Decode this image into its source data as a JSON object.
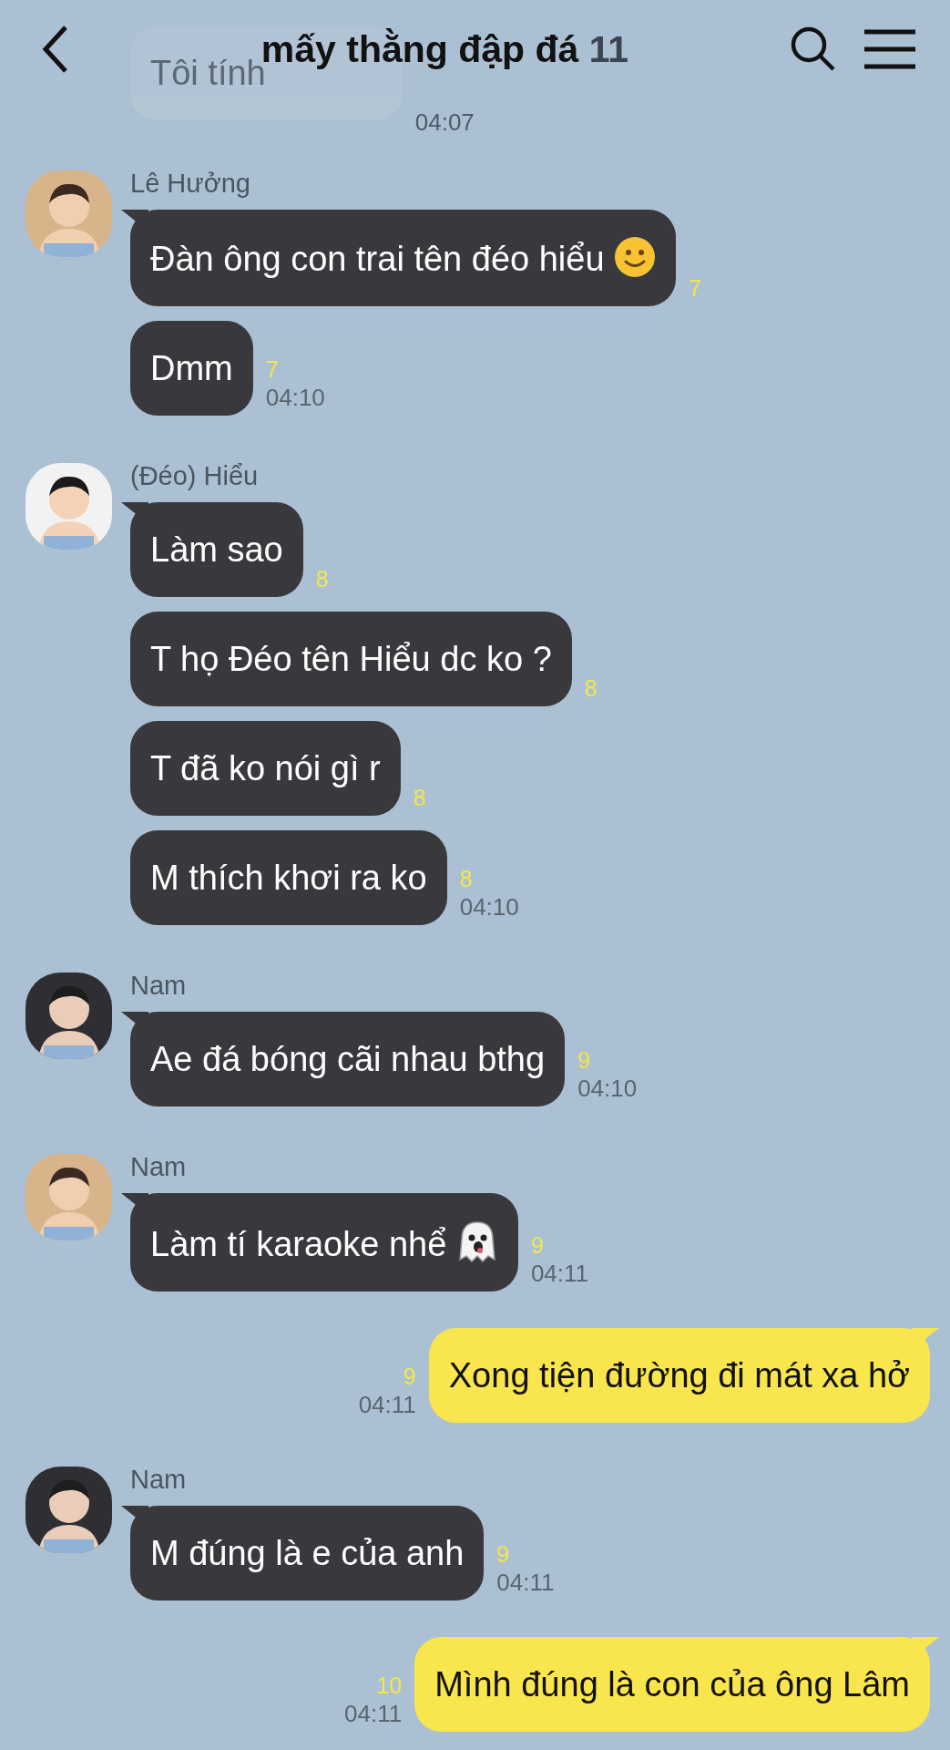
{
  "header": {
    "title": "mấy thằng đập đá",
    "member_count": "11"
  },
  "groups": [
    {
      "kind": "partial",
      "messages": [
        {
          "text": "Tôi tính",
          "time": "04:07"
        }
      ]
    },
    {
      "kind": "incoming",
      "sender": "Lê Hưởng",
      "avatar": {
        "kind": "picture"
      },
      "messages": [
        {
          "kind": "text_smiley",
          "text": "Đàn ông con trai tên đéo hiểu",
          "unread": "7"
        },
        {
          "text": "Dmm",
          "unread": "7",
          "time": "04:10"
        }
      ]
    },
    {
      "kind": "incoming",
      "sender": "(Đéo) Hiểu",
      "avatar": {
        "kind": "picture"
      },
      "messages": [
        {
          "text": "Làm sao",
          "unread": "8"
        },
        {
          "text": "T họ Đéo tên Hiểu dc ko ?",
          "unread": "8"
        },
        {
          "text": "T đã ko nói gì r",
          "unread": "8"
        },
        {
          "text": "M thích khơi ra ko",
          "unread": "8",
          "time": "04:10"
        }
      ]
    },
    {
      "kind": "incoming",
      "sender": "Nam",
      "avatar": {
        "kind": "picture"
      },
      "messages": [
        {
          "text": "Ae đá bóng cãi nhau bthg",
          "unread": "9",
          "time": "04:10"
        }
      ]
    },
    {
      "kind": "incoming",
      "sender": "Nam",
      "avatar": {
        "kind": "picture"
      },
      "messages": [
        {
          "kind": "text_ghost",
          "text": "Làm tí karaoke nhể",
          "unread": "9",
          "time": "04:11"
        }
      ]
    },
    {
      "kind": "outgoing",
      "messages": [
        {
          "text": "Xong tiện đường đi mát xa hở",
          "unread": "9",
          "time": "04:11"
        }
      ]
    },
    {
      "kind": "incoming",
      "sender": "Nam",
      "avatar": {
        "kind": "picture"
      },
      "messages": [
        {
          "text": "M đúng là e của anh",
          "unread": "9",
          "time": "04:11"
        }
      ]
    },
    {
      "kind": "outgoing",
      "messages": [
        {
          "text": "Mình đúng là con của ông Lâm",
          "unread": "10",
          "time": "04:11"
        }
      ]
    }
  ]
}
